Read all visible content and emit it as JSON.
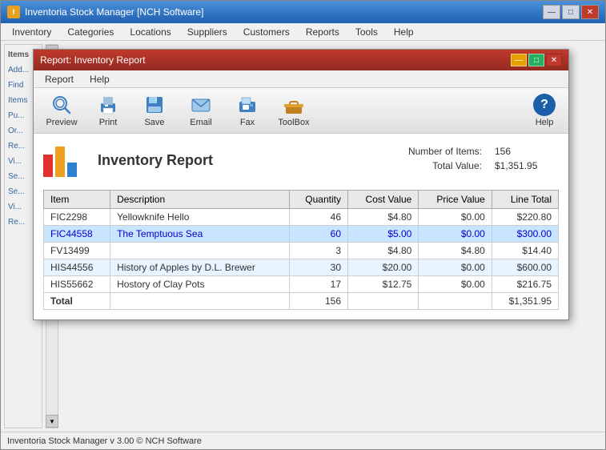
{
  "mainWindow": {
    "title": "Inventoria Stock Manager [NCH Software]",
    "icon": "I",
    "menuItems": [
      "Inventory",
      "Categories",
      "Locations",
      "Suppliers",
      "Customers",
      "Reports",
      "Tools",
      "Help"
    ],
    "windowControls": {
      "minimize": "—",
      "maximize": "□",
      "close": "✕"
    }
  },
  "sidebar": {
    "items": [
      {
        "label": "Items",
        "header": true
      },
      {
        "label": "Add..."
      },
      {
        "label": "Find"
      },
      {
        "label": "Items"
      },
      {
        "label": "Pu..."
      },
      {
        "label": "Or..."
      },
      {
        "label": "Re..."
      },
      {
        "label": "Vi..."
      },
      {
        "label": "Se..."
      },
      {
        "label": "Se..."
      },
      {
        "label": "Vi..."
      },
      {
        "label": "Re..."
      }
    ]
  },
  "statusbar": {
    "text": "Inventoria Stock Manager v 3.00 © NCH Software"
  },
  "modalDialog": {
    "title": "Report: Inventory Report",
    "windowControls": {
      "minimize": "—",
      "maximize": "□",
      "close": "✕"
    },
    "menuItems": [
      "Report",
      "Help"
    ],
    "toolbar": {
      "buttons": [
        {
          "label": "Preview",
          "icon": "🔍"
        },
        {
          "label": "Print",
          "icon": "🖨"
        },
        {
          "label": "Save",
          "icon": "💾"
        },
        {
          "label": "Email",
          "icon": "✉"
        },
        {
          "label": "Fax",
          "icon": "📠"
        },
        {
          "label": "ToolBox",
          "icon": "🧰"
        }
      ],
      "helpLabel": "Help"
    },
    "report": {
      "title": "Inventory Report",
      "stats": {
        "numItemsLabel": "Number of Items:",
        "numItemsValue": "156",
        "totalValueLabel": "Total Value:",
        "totalValueValue": "$1,351.95"
      },
      "tableHeaders": [
        "Item",
        "Description",
        "Quantity",
        "Cost Value",
        "Price Value",
        "Line Total"
      ],
      "tableRows": [
        {
          "item": "FIC2298",
          "description": "Yellowknife Hello",
          "quantity": "46",
          "costValue": "$4.80",
          "priceValue": "$0.00",
          "lineTotal": "$220.80",
          "highlighted": false
        },
        {
          "item": "FIC44558",
          "description": "The Temptuous Sea",
          "quantity": "60",
          "costValue": "$5.00",
          "priceValue": "$0.00",
          "lineTotal": "$300.00",
          "highlighted": true
        },
        {
          "item": "FV13499",
          "description": "",
          "quantity": "3",
          "costValue": "$4.80",
          "priceValue": "$4.80",
          "lineTotal": "$14.40",
          "highlighted": false
        },
        {
          "item": "HIS44556",
          "description": "History of Apples by D.L. Brewer",
          "quantity": "30",
          "costValue": "$20.00",
          "priceValue": "$0.00",
          "lineTotal": "$600.00",
          "highlighted": false
        },
        {
          "item": "HIS55662",
          "description": "Hostory of Clay Pots",
          "quantity": "17",
          "costValue": "$12.75",
          "priceValue": "$0.00",
          "lineTotal": "$216.75",
          "highlighted": false
        }
      ],
      "totalRow": {
        "label": "Total",
        "quantity": "156",
        "lineTotal": "$1,351.95"
      }
    }
  }
}
